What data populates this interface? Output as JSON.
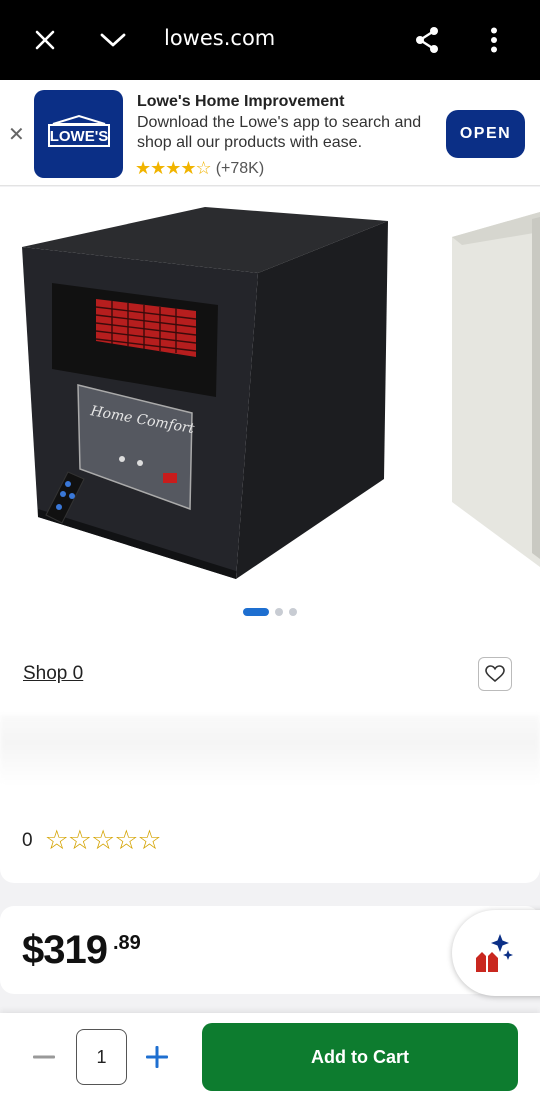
{
  "browser": {
    "url": "lowes.com",
    "icons": [
      "close-icon",
      "chevron-down-icon",
      "share-icon",
      "more-vert-icon"
    ]
  },
  "app_banner": {
    "close_glyph": "✕",
    "logo_text": "LOWE'S",
    "title": "Lowe's Home Improvement",
    "description": "Download the Lowe's app to search and shop all our products with ease.",
    "stars": "★★★★☆",
    "rating_count": "(+78K)",
    "open_label": "OPEN",
    "brand_color": "#0b2f86"
  },
  "product": {
    "panel_text": "Home Comfort",
    "gallery_dots": 3,
    "active_dot": 0,
    "shop_link": "Shop 0",
    "review_count": "0",
    "stars": "☆☆☆☆☆",
    "price_dollars": "$319",
    "price_cents": ".89"
  },
  "cart_bar": {
    "minus_glyph": "—",
    "quantity": "1",
    "plus_glyph": "+",
    "add_label": "Add to Cart",
    "button_color": "#0d7c2f"
  }
}
